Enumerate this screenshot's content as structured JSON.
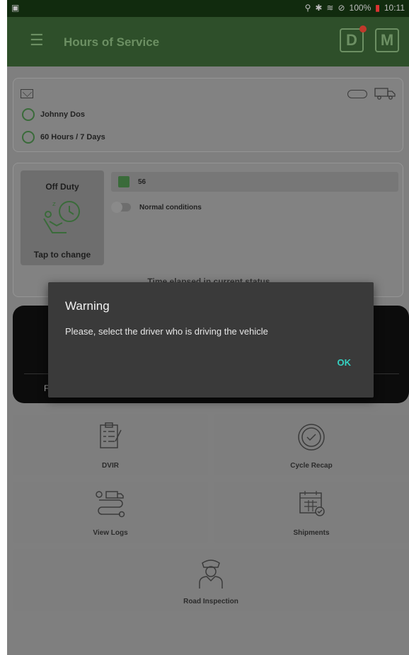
{
  "status_bar": {
    "battery_text": "100%",
    "time": "10:11"
  },
  "app_bar": {
    "title": "Hours of Service",
    "logo_d": "D",
    "logo_m": "M"
  },
  "driver": {
    "name": "Johnny Dos",
    "cycle": "60 Hours / 7 Days"
  },
  "status": {
    "duty_label": "Off Duty",
    "tap_label": "Tap to change",
    "vehicle": "56",
    "conditions": "Normal conditions",
    "elapsed_label": "Time elapsed in current status"
  },
  "black_panel": {
    "partial_text": "F"
  },
  "tiles": {
    "dvir": "DVIR",
    "cycle_recap": "Cycle Recap",
    "view_logs": "View Logs",
    "shipments": "Shipments",
    "road_inspection": "Road Inspection"
  },
  "dialog": {
    "title": "Warning",
    "message": "Please, select the driver who is driving the vehicle",
    "ok_label": "OK"
  },
  "colors": {
    "appbar": "#2e4f2a",
    "accent_green": "#3a6b3a",
    "dialog_bg": "#3a3a3a",
    "ok_teal": "#34d1c1"
  }
}
